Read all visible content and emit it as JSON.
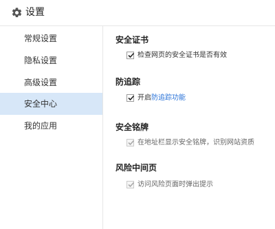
{
  "header": {
    "title": "设置",
    "icon": "gear-icon"
  },
  "sidebar": {
    "items": [
      {
        "label": "常规设置",
        "active": false
      },
      {
        "label": "隐私设置",
        "active": false
      },
      {
        "label": "高级设置",
        "active": false
      },
      {
        "label": "安全中心",
        "active": true
      },
      {
        "label": "我的应用",
        "active": false
      }
    ]
  },
  "sections": [
    {
      "title": "安全证书",
      "option": {
        "label": "检查网页的安全证书是否有效",
        "checked": true,
        "disabled": false
      }
    },
    {
      "title": "防追踪",
      "option": {
        "label_prefix": "开启",
        "label_link": "防追踪功能",
        "checked": true,
        "disabled": false
      }
    },
    {
      "title": "安全铭牌",
      "option": {
        "label": "在地址栏显示安全铭牌，识别网站资质",
        "checked": true,
        "disabled": true
      }
    },
    {
      "title": "风险中间页",
      "option": {
        "label": "访问风险页面时弹出提示",
        "checked": true,
        "disabled": true
      }
    }
  ],
  "colors": {
    "active_bg": "#d7e7f8",
    "link": "#2a73d8",
    "border": "#e6e6e6"
  }
}
